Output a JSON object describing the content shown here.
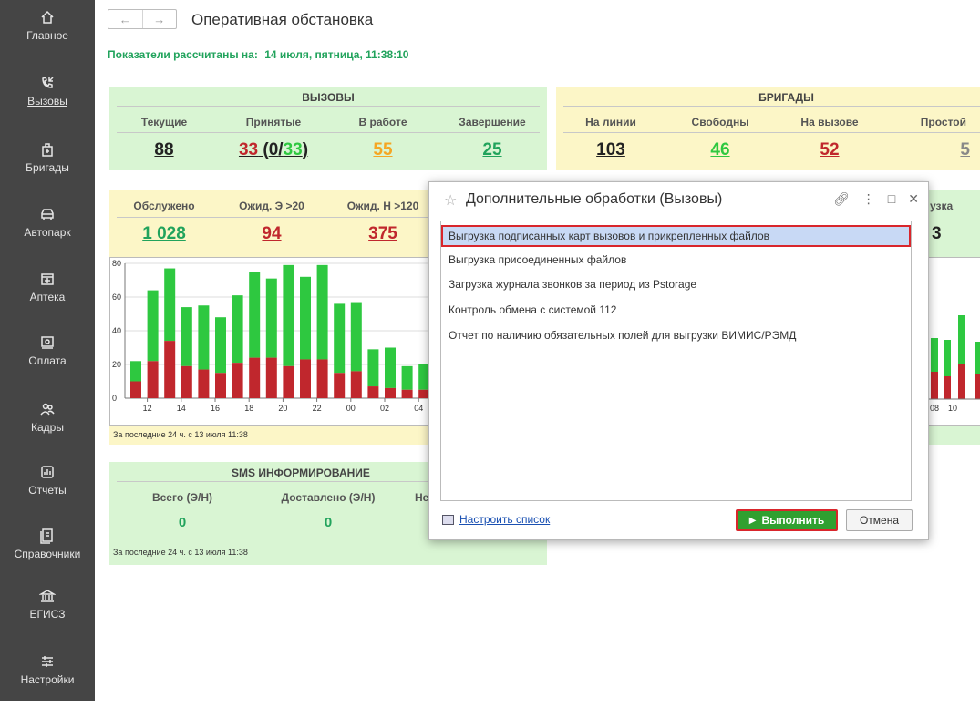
{
  "sidebar": {
    "items": [
      {
        "label": "Главное",
        "icon": "home-icon"
      },
      {
        "label": "Вызовы",
        "icon": "phone-call-icon"
      },
      {
        "label": "Бригады",
        "icon": "team-icon"
      },
      {
        "label": "Автопарк",
        "icon": "car-icon"
      },
      {
        "label": "Аптека",
        "icon": "pharmacy-icon"
      },
      {
        "label": "Оплата",
        "icon": "payment-icon"
      },
      {
        "label": "Кадры",
        "icon": "staff-icon"
      },
      {
        "label": "Отчеты",
        "icon": "reports-icon"
      },
      {
        "label": "Справочники",
        "icon": "reference-icon"
      },
      {
        "label": "ЕГИСЗ",
        "icon": "government-icon"
      },
      {
        "label": "Настройки",
        "icon": "settings-icon"
      }
    ]
  },
  "header": {
    "back": "←",
    "forward": "→",
    "title": "Оперативная обстановка",
    "calc_label": "Показатели рассчитаны на:",
    "calc_value": "14 июля, пятница, 11:38:10"
  },
  "calls": {
    "title": "ВЫЗОВЫ",
    "headers": [
      "Текущие",
      "Принятые",
      "В работе",
      "Завершение"
    ],
    "current": "88",
    "accepted_a": "33",
    "accepted_open": "(",
    "accepted_b": "0",
    "accepted_slash": "/",
    "accepted_c": "33",
    "accepted_close": ")",
    "in_work": "55",
    "completing": "25"
  },
  "brigades": {
    "title": "БРИГАДЫ",
    "headers": [
      "На линии",
      "Свободны",
      "На вызове",
      "Простой"
    ],
    "values": [
      "103",
      "46",
      "52",
      "5"
    ]
  },
  "served": {
    "headers": [
      "Обслужено",
      "Ожид. Э >20",
      "Ожид. Н >120"
    ],
    "values": [
      "1 028",
      "94",
      "375"
    ],
    "footnote": "За последние 24 ч. с 13 июля 11:38"
  },
  "right_partial": {
    "header": "узка",
    "value": "3",
    "x_ticks": [
      "08",
      "10"
    ]
  },
  "sms": {
    "title": "SMS ИНФОРМИРОВАНИЕ",
    "headers": [
      "Всего (Э/Н)",
      "Доставлено (Э/Н)",
      "Не"
    ],
    "values": [
      "0",
      "0"
    ],
    "footnote": "За последние 24 ч. с 13 июля 11:38"
  },
  "dialog": {
    "title": "Дополнительные обработки (Вызовы)",
    "items": [
      "Выгрузка подписанных карт вызовов и прикрепленных файлов",
      "Выгрузка присоединенных файлов",
      "Загрузка журнала звонков за период из Pstorage",
      "Контроль обмена с системой 112",
      "Отчет по наличию обязательных полей для выгрузки ВИМИС/РЭМД"
    ],
    "configure_link": "Настроить список",
    "run_button": "Выполнить",
    "cancel_button": "Отмена"
  },
  "colors": {
    "accent_green": "#21a35c",
    "bar_green": "#2ec840",
    "bar_red": "#c0272d",
    "warn_orange": "#f5a623",
    "panel_green": "#d9f5d3",
    "panel_yellow": "#fcf6c7"
  },
  "chart_data": {
    "type": "bar",
    "stacked": true,
    "y_ticks": [
      "0",
      "20",
      "40",
      "60",
      "80"
    ],
    "ylim": [
      0,
      80
    ],
    "x_ticks": [
      "12",
      "14",
      "16",
      "18",
      "20",
      "22",
      "00",
      "02",
      "04"
    ],
    "series": [
      {
        "color": "#c0272d",
        "values": [
          10,
          22,
          34,
          19,
          17,
          15,
          21,
          24,
          24,
          19,
          23,
          23,
          15,
          16,
          7,
          6,
          5,
          5
        ]
      },
      {
        "color": "#2ec840",
        "values": [
          22,
          64,
          77,
          54,
          55,
          48,
          61,
          75,
          71,
          79,
          72,
          79,
          56,
          57,
          29,
          30,
          19,
          20
        ]
      }
    ],
    "series_totals": true
  }
}
